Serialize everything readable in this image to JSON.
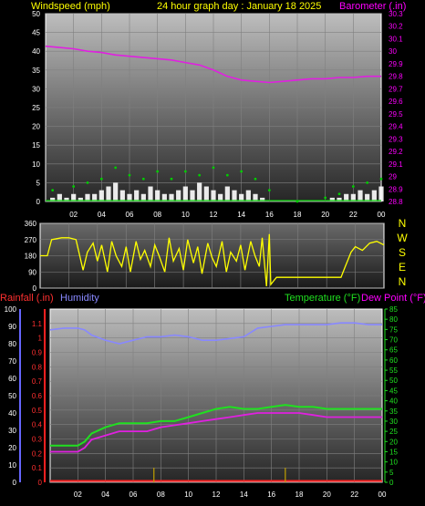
{
  "header": {
    "windspeed_label": "Windspeed (mph)",
    "title": "24 hour graph day : January 18 2025",
    "barometer_label": "Barometer (.in)"
  },
  "compass_letters": [
    "N",
    "W",
    "S",
    "E",
    "N"
  ],
  "lower_header": {
    "rainfall_label": "Rainfall (.in)",
    "humidity_label": "Humidity",
    "temperature_label": "Temperature (°F)",
    "dewpoint_label": "Dew Point (°F)"
  },
  "colors": {
    "wind": "#ffffff",
    "gust": "#00cc00",
    "barometer": "#e020e0",
    "direction": "#ffff00",
    "rain": "#ff2020",
    "humidity": "#8888ff",
    "temperature": "#20e020",
    "dewpoint": "#e020e0",
    "rain_rate": "#c0a000"
  },
  "chart_data": [
    {
      "type": "line",
      "title": "24 hour graph day : January 18 2025",
      "x_ticks": [
        "02",
        "04",
        "06",
        "08",
        "10",
        "12",
        "14",
        "16",
        "18",
        "20",
        "22",
        "00"
      ],
      "xlim_hours": [
        0,
        24
      ],
      "left_axis": {
        "label": "Windspeed (mph)",
        "ylim": [
          0,
          50
        ],
        "ticks": [
          0,
          5,
          10,
          15,
          20,
          25,
          30,
          35,
          40,
          45,
          50
        ]
      },
      "right_axis": {
        "label": "Barometer (.in)",
        "ylim": [
          28.8,
          30.3
        ],
        "ticks": [
          28.8,
          28.9,
          29,
          29.1,
          29.2,
          29.3,
          29.4,
          29.5,
          29.6,
          29.7,
          29.8,
          29.9,
          30,
          30.1,
          30.2,
          30.3
        ]
      },
      "series": [
        {
          "name": "Barometer",
          "axis": "right",
          "x": [
            0,
            1,
            2,
            3,
            4,
            5,
            6,
            7,
            8,
            9,
            10,
            11,
            12,
            13,
            14,
            15,
            16,
            17,
            18,
            19,
            20,
            21,
            22,
            23,
            24
          ],
          "y": [
            30.04,
            30.03,
            30.02,
            30.0,
            29.99,
            29.97,
            29.96,
            29.95,
            29.94,
            29.93,
            29.91,
            29.89,
            29.85,
            29.8,
            29.77,
            29.76,
            29.75,
            29.76,
            29.77,
            29.78,
            29.78,
            29.79,
            29.79,
            29.8,
            29.8
          ]
        },
        {
          "name": "Wind",
          "axis": "left",
          "x": [
            0.5,
            1,
            1.5,
            2,
            2.5,
            3,
            3.5,
            4,
            4.5,
            5,
            5.5,
            6,
            6.5,
            7,
            7.5,
            8,
            8.5,
            9,
            9.5,
            10,
            10.5,
            11,
            11.5,
            12,
            12.5,
            13,
            13.5,
            14,
            14.5,
            15,
            15.5,
            16,
            17,
            18,
            19,
            20,
            20.5,
            21,
            21.5,
            22,
            22.5,
            23,
            23.5,
            24
          ],
          "y": [
            1,
            2,
            1,
            2,
            1,
            2,
            2,
            3,
            4,
            5,
            3,
            2,
            3,
            2,
            4,
            3,
            2,
            2,
            3,
            4,
            3,
            5,
            4,
            3,
            2,
            4,
            3,
            2,
            3,
            2,
            1,
            0,
            0,
            0,
            0,
            0,
            1,
            1,
            2,
            2,
            3,
            2,
            3,
            4
          ]
        },
        {
          "name": "Gust",
          "axis": "left",
          "x": [
            0.5,
            2,
            3,
            4,
            5,
            6,
            7,
            8,
            9,
            10,
            11,
            12,
            13,
            14,
            15,
            16,
            18,
            20,
            21,
            22,
            23,
            24
          ],
          "y": [
            3,
            4,
            5,
            6,
            9,
            7,
            6,
            8,
            6,
            8,
            7,
            9,
            7,
            8,
            6,
            3,
            0,
            1,
            2,
            4,
            5,
            6
          ]
        }
      ]
    },
    {
      "type": "line",
      "series_name": "Wind direction",
      "x_ticks": [
        "02",
        "04",
        "06",
        "08",
        "10",
        "12",
        "14",
        "16",
        "18",
        "20",
        "22",
        "00"
      ],
      "xlim_hours": [
        0,
        24
      ],
      "ylim": [
        0,
        360
      ],
      "y_ticks": [
        0,
        90,
        180,
        270,
        360
      ],
      "right_labels": [
        "N",
        "W",
        "S",
        "E",
        "N"
      ],
      "x": [
        0,
        0.5,
        0.8,
        1.5,
        2.0,
        2.5,
        3.0,
        3.3,
        3.7,
        4.0,
        4.3,
        4.7,
        5.0,
        5.3,
        5.7,
        6.0,
        6.3,
        6.7,
        7.0,
        7.3,
        7.7,
        8.0,
        8.3,
        8.7,
        9.0,
        9.3,
        9.7,
        10.0,
        10.3,
        10.7,
        11.0,
        11.3,
        11.7,
        12.0,
        12.3,
        12.7,
        13.0,
        13.3,
        13.7,
        14.0,
        14.3,
        14.7,
        15.0,
        15.3,
        15.5,
        15.8,
        16.0,
        16.1,
        16.3,
        16.5,
        17.0,
        18.0,
        19.0,
        20.0,
        21.0,
        21.3,
        21.7,
        22.0,
        22.5,
        23.0,
        23.5,
        24.0
      ],
      "y": [
        180,
        180,
        270,
        280,
        280,
        270,
        100,
        200,
        250,
        150,
        240,
        90,
        260,
        180,
        120,
        230,
        90,
        260,
        160,
        210,
        120,
        240,
        180,
        90,
        280,
        150,
        220,
        100,
        270,
        140,
        230,
        80,
        250,
        170,
        120,
        260,
        90,
        200,
        150,
        240,
        100,
        260,
        180,
        120,
        280,
        10,
        300,
        20,
        40,
        60,
        60,
        60,
        60,
        60,
        60,
        120,
        200,
        230,
        210,
        250,
        260,
        240
      ]
    },
    {
      "type": "line",
      "x_ticks": [
        "02",
        "04",
        "06",
        "08",
        "10",
        "12",
        "14",
        "16",
        "18",
        "20",
        "22",
        "00"
      ],
      "xlim_hours": [
        0,
        24
      ],
      "humidity_axis": {
        "label": "Humidity",
        "ylim": [
          0,
          100
        ],
        "ticks": [
          0,
          10,
          20,
          30,
          40,
          50,
          60,
          70,
          80,
          90,
          100
        ]
      },
      "rainfall_axis": {
        "label": "Rainfall (.in)",
        "ylim": [
          0,
          1.2
        ],
        "ticks": [
          0,
          0.1,
          0.2,
          0.3,
          0.4,
          0.5,
          0.6,
          0.7,
          0.8,
          0.9,
          1,
          1.1
        ]
      },
      "temperature_axis": {
        "label": "Temperature (°F)",
        "ylim": [
          0,
          85
        ],
        "ticks": [
          0,
          5,
          10,
          15,
          20,
          25,
          30,
          35,
          40,
          45,
          50,
          55,
          60,
          65,
          70,
          75,
          80,
          85
        ]
      },
      "series": [
        {
          "name": "Humidity",
          "axis": "humidity",
          "x": [
            0,
            1,
            2,
            2.5,
            3,
            4,
            5,
            6,
            7,
            8,
            9,
            10,
            11,
            12,
            13,
            14,
            15,
            16,
            17,
            18,
            19,
            20,
            21,
            22,
            23,
            24
          ],
          "y": [
            88,
            89,
            89,
            88,
            85,
            82,
            80,
            82,
            84,
            84,
            85,
            84,
            82,
            82,
            83,
            84,
            89,
            90,
            91,
            91,
            91,
            91,
            92,
            92,
            91,
            91
          ]
        },
        {
          "name": "Temperature",
          "axis": "temperature",
          "x": [
            0,
            1,
            2,
            2.5,
            3,
            4,
            5,
            6,
            7,
            8,
            9,
            10,
            11,
            12,
            13,
            14,
            15,
            16,
            17,
            18,
            19,
            20,
            21,
            22,
            23,
            24
          ],
          "y": [
            18,
            18,
            18,
            20,
            24,
            27,
            29,
            29,
            29,
            30,
            30,
            32,
            34,
            36,
            37,
            36,
            36,
            37,
            38,
            37,
            37,
            36,
            36,
            36,
            36,
            36
          ]
        },
        {
          "name": "Dew Point",
          "axis": "temperature",
          "x": [
            0,
            1,
            2,
            2.5,
            3,
            4,
            5,
            6,
            7,
            8,
            9,
            10,
            11,
            12,
            13,
            14,
            15,
            16,
            17,
            18,
            19,
            20,
            21,
            22,
            23,
            24
          ],
          "y": [
            15,
            15,
            15,
            17,
            21,
            23,
            25,
            25,
            25,
            27,
            28,
            29,
            30,
            31,
            32,
            33,
            34,
            34,
            34,
            34,
            33,
            32,
            32,
            32,
            32,
            32
          ]
        },
        {
          "name": "Rainfall",
          "axis": "rainfall",
          "x": [
            0,
            24
          ],
          "y": [
            0,
            0
          ]
        },
        {
          "name": "Rain rate",
          "axis": "rainfall",
          "x": [
            7.5,
            17
          ],
          "y": [
            0.1,
            0.1
          ]
        }
      ]
    }
  ]
}
